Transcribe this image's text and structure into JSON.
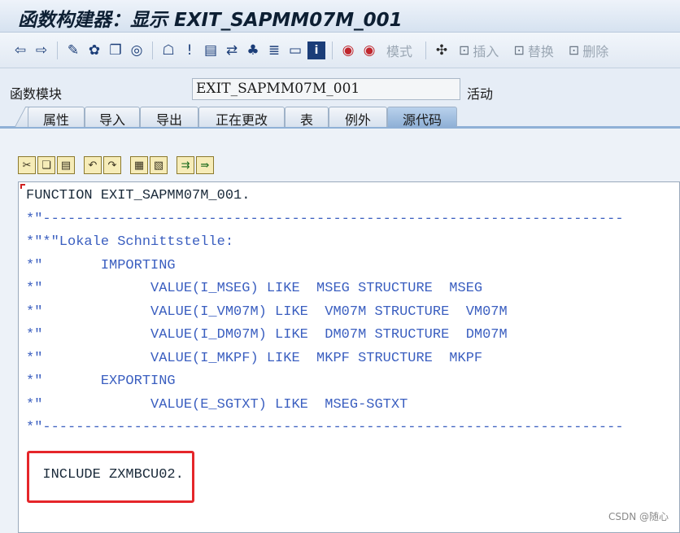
{
  "window": {
    "title": "函数构建器：显示 EXIT_SAPMM07M_001"
  },
  "toolbar": {
    "buttons": [
      "back",
      "forward",
      "check",
      "activate",
      "test",
      "where-used",
      "display-object-list",
      "set-breakpoint",
      "pattern",
      "pretty-printer",
      "hierarchy",
      "display",
      "info"
    ],
    "mode_label": "模式",
    "insert_label": "插入",
    "replace_label": "替换",
    "delete_label": "删除"
  },
  "module": {
    "label": "函数模块",
    "name": "EXIT_SAPMM07M_001",
    "status": "活动"
  },
  "tabs": [
    {
      "label": "属性",
      "active": false
    },
    {
      "label": "导入",
      "active": false
    },
    {
      "label": "导出",
      "active": false
    },
    {
      "label": "正在更改",
      "active": false
    },
    {
      "label": "表",
      "active": false
    },
    {
      "label": "例外",
      "active": false
    },
    {
      "label": "源代码",
      "active": true
    }
  ],
  "code": {
    "lines": [
      {
        "text": "FUNCTION EXIT_SAPMM07M_001.",
        "type": "code"
      },
      {
        "text": "*\"----------------------------------------------------------------------",
        "type": "comment"
      },
      {
        "text": "*\"*\"Lokale Schnittstelle:",
        "type": "comment"
      },
      {
        "text": "*\"       IMPORTING",
        "type": "comment"
      },
      {
        "text": "*\"             VALUE(I_MSEG) LIKE  MSEG STRUCTURE  MSEG",
        "type": "comment"
      },
      {
        "text": "*\"             VALUE(I_VM07M) LIKE  VM07M STRUCTURE  VM07M",
        "type": "comment"
      },
      {
        "text": "*\"             VALUE(I_DM07M) LIKE  DM07M STRUCTURE  DM07M",
        "type": "comment"
      },
      {
        "text": "*\"             VALUE(I_MKPF) LIKE  MKPF STRUCTURE  MKPF",
        "type": "comment"
      },
      {
        "text": "*\"       EXPORTING",
        "type": "comment"
      },
      {
        "text": "*\"             VALUE(E_SGTXT) LIKE  MSEG-SGTXT",
        "type": "comment"
      },
      {
        "text": "*\"----------------------------------------------------------------------",
        "type": "comment"
      },
      {
        "text": "",
        "type": "code"
      },
      {
        "text": "  INCLUDE ZXMBCU02.",
        "type": "code"
      }
    ]
  },
  "colors": {
    "highlight": "#e5262a",
    "comment": "#3b5fc0",
    "active_tab": "#8fb0d6"
  },
  "watermark": "CSDN @随心"
}
